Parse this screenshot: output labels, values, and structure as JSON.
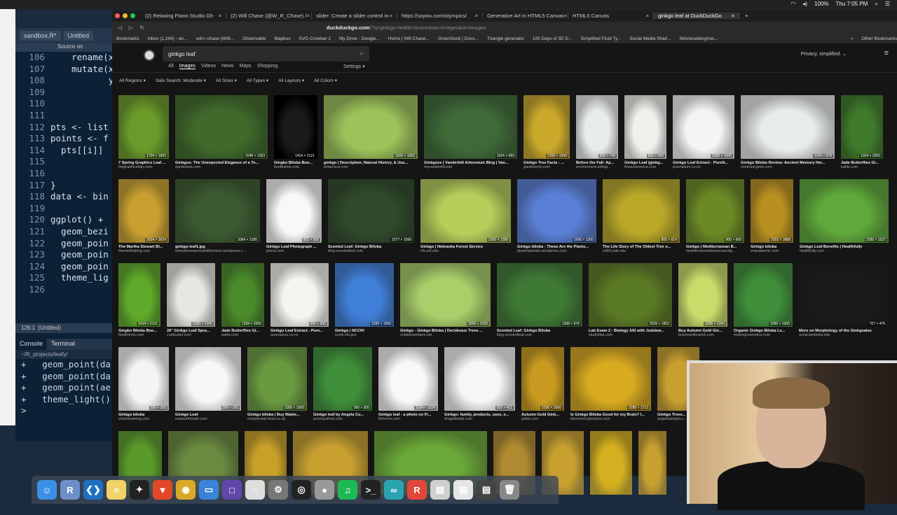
{
  "menubar": {
    "battery": "100%",
    "clock": "Thu 7:05 PM"
  },
  "rstudio": {
    "tabs": [
      "sandbox.R*",
      "Untitled"
    ],
    "source_label": "Source on",
    "code": [
      {
        "n": "106",
        "t": "    rename(x"
      },
      {
        "n": "107",
        "t": "    mutate(x"
      },
      {
        "n": "108",
        "t": "           y"
      },
      {
        "n": "109",
        "t": ""
      },
      {
        "n": "110",
        "t": ""
      },
      {
        "n": "111",
        "t": ""
      },
      {
        "n": "112",
        "t": "pts <- list"
      },
      {
        "n": "113",
        "t": "points <- f"
      },
      {
        "n": "114",
        "t": "  pts[[i]]"
      },
      {
        "n": "115",
        "t": ""
      },
      {
        "n": "116",
        "t": ""
      },
      {
        "n": "117",
        "t": "}"
      },
      {
        "n": "118",
        "t": "data <- bin"
      },
      {
        "n": "119",
        "t": ""
      },
      {
        "n": "120",
        "t": "ggplot() +"
      },
      {
        "n": "121",
        "t": "  geom_bezi"
      },
      {
        "n": "122",
        "t": "  geom_poin"
      },
      {
        "n": "123",
        "t": "  geom_poin"
      },
      {
        "n": "124",
        "t": "  geom_poin"
      },
      {
        "n": "125",
        "t": "  theme_lig"
      },
      {
        "n": "126",
        "t": ""
      }
    ],
    "cursor_pos": "126:1",
    "scope": "(Untitled)",
    "console_tabs": [
      "Console",
      "Terminal"
    ],
    "console_path": "~/R_projects/leafy/",
    "console_lines": [
      "+   geom_point(da",
      "+   geom_point(da",
      "+   geom_point(ae",
      "+   theme_light()",
      ">"
    ]
  },
  "browser": {
    "tabs": [
      {
        "title": "(2) Relaxing Piano Studio Gh"
      },
      {
        "title": "(2) Will Chase (@W_R_Chase) /"
      },
      {
        "title": "slider: Create a slider control in"
      },
      {
        "title": "https://sxywu.com/olympics/"
      },
      {
        "title": "Generative Art in HTML5 Canvas"
      },
      {
        "title": "HTML5 Canvas"
      },
      {
        "title": "ginkgo leaf at DuckDuckGo"
      }
    ],
    "url_host": "duckduckgo.com",
    "url_rest": "/?q=ginkgo+leaf&t=brave&iax=images&ia=images",
    "bookmarks": [
      "Bookmarks",
      "Inbox (1,249) - wc...",
      "will-r-chase (Willi...",
      "Observable",
      "Mapbox",
      "SVG Crowbar 2",
      "My Drive - Google...",
      "Home | Will Chase...",
      "GreenSock | Docs...",
      "Triangle generator",
      "100 Days of 3D D...",
      "Simplified Fluid Ty...",
      "Social Media Shari...",
      "felixrieseberg/res...",
      "»",
      "Other Bookmarks"
    ]
  },
  "ddg": {
    "query": "ginkgo leaf",
    "privacy": "Privacy, simplified. ⌄",
    "nav": [
      "All",
      "Images",
      "Videos",
      "News",
      "Maps",
      "Shopping"
    ],
    "settings": "Settings ▾",
    "filters": [
      "All Regions ▾",
      "Safe Search: Moderate ▾",
      "All Sizes ▾",
      "All Types ▾",
      "All Layouts ▾",
      "All Colors ▾"
    ],
    "rows": [
      [
        {
          "c": "7 Spring Graphics Leaf ...",
          "s": "thegraphicsfairy.com",
          "d": "1724 × 1800"
        },
        {
          "c": "Ginkgos: The Unexpected Elegance of a To...",
          "s": "gardenista.com",
          "d": "2048 × 1363"
        },
        {
          "c": "Gingko Biloba Boo...",
          "s": "foodtrients.com",
          "d": "1414 × 2121"
        },
        {
          "c": "ginkgo | Description, Natural History, & Use...",
          "s": "britannica.com",
          "d": "1600 × 1063"
        },
        {
          "c": "Ginkgoes | Vanderbilt Arboretum Blog | Van...",
          "s": "myvanderbilt.edu",
          "d": "1024 × 683"
        },
        {
          "c": "Ginkgo Tree Facts - ...",
          "s": "gardenerdy.com",
          "d": "1200 × 1594"
        },
        {
          "c": "Before the Fall: Ap...",
          "s": "environment.arlingt...",
          "d": "500 × 749"
        },
        {
          "c": "Ginkgo Leaf (ginkg...",
          "s": "fineartamerica.com",
          "d": "600 × 900"
        },
        {
          "c": "Ginkgo Leaf Extract - PureN...",
          "s": "purenature.co.nz",
          "d": "1000 × 1000"
        },
        {
          "c": "Ginkgo Biloba Review: Ancient Memory Her...",
          "s": "nootropicgeek.com",
          "d": "1024 × 678"
        },
        {
          "c": "Jade Butterflies Gi...",
          "s": "pahls.com",
          "d": "1334 × 2000"
        }
      ],
      [
        {
          "c": "The Martha Stewart Bl...",
          "s": "themarthablog.com",
          "d": "3024 × 3024"
        },
        {
          "c": "ginkgo-leaf1.jpg",
          "s": "whendinosaursruledthemind.wordpress.c...",
          "d": "3084 × 2185"
        },
        {
          "c": "Ginkgo Leaf Photograph ...",
          "s": "pixels.com",
          "d": "852 × 900"
        },
        {
          "c": "Scented Leaf: Ginkgo Biloba",
          "s": "blog.scentedleaf.com",
          "d": "1577 × 1099"
        },
        {
          "c": "Ginkgo | Nebraska Forest Service",
          "s": "nfs.unl.edu",
          "d": "1920 × 1280"
        },
        {
          "c": "Ginkgo biloba - These Are the Plants...",
          "s": "plantmaterials.wordpress.com",
          "d": "1600 × 1200"
        },
        {
          "c": "The Life Story of The Oldest Tree o...",
          "s": "e360.yale.edu",
          "d": "800 × 614"
        },
        {
          "c": "Ginkgo | Mediterranean B...",
          "s": "mediterraneanbonsai.wordp...",
          "d": "900 × 900"
        },
        {
          "c": "Ginkgo biloba",
          "s": "enacademic.com",
          "d": "2592 × 3888"
        },
        {
          "c": "Ginkgo Leaf Benefits | Healthfully",
          "s": "healthfully.com",
          "d": "2290 × 1527"
        }
      ],
      [
        {
          "c": "Gingko Biloba Boo...",
          "s": "foodtrients.com",
          "d": "1414 × 2121"
        },
        {
          "c": "26\" Ginkgo Leaf Spra...",
          "s": "craftoutlet.com",
          "d": "1000 × 1000"
        },
        {
          "c": "Jade Butterflies Gi...",
          "s": "pahls.com",
          "d": "1334 × 2000"
        },
        {
          "c": "Ginkgo Leaf Extract - Pure...",
          "s": "purenature.co.nz",
          "d": "600 × 600"
        },
        {
          "c": "Ginkgo | NCCIH",
          "s": "nccih.nih.gov",
          "d": "1500 × 1500"
        },
        {
          "c": "Ginkgo - Ginkgo Biloba | Deciduous Trees ...",
          "s": "coldstreamfarm.net",
          "d": "3500 × 2336"
        },
        {
          "c": "Scented Leaf: Ginkgo Biloba",
          "s": "blog.scentedleaf.com",
          "d": "1398 × 976"
        },
        {
          "c": "Lab Exam 2 - Biology 342 with Judziew...",
          "s": "studyblue.com",
          "d": "2526 × 1803"
        },
        {
          "c": "Buy Autumn Gold Gin...",
          "s": "bowerandbranch.com",
          "d": "1056 × 1260"
        },
        {
          "c": "Organic Ginkgo Biloba Le...",
          "s": "makingcosmetics.com",
          "d": "1000 × 1000"
        },
        {
          "c": "More on Morphology of the Ginkgoales",
          "s": "ucmp.berkeley.edu",
          "d": "707 × 475"
        }
      ],
      [
        {
          "c": "Ginkgo biloba",
          "s": "visionlearning.com",
          "d": "200 × 300"
        },
        {
          "c": "Ginkgo Leaf",
          "s": "eastearthtrade.com",
          "d": "200 × 160"
        },
        {
          "c": "Ginkgo biloba | Buy Maide...",
          "s": "ornamental-trees.co.uk",
          "d": "1000 × 1000"
        },
        {
          "c": "Ginkgo leaf by Angela Cu...",
          "s": "preciousflora.com",
          "d": "300 × 300"
        },
        {
          "c": "Ginkgo leaf - a photo on Fl...",
          "s": "flickriver.com",
          "d": "1024 × 1024"
        },
        {
          "c": "Ginkgo: family, products, uses, e...",
          "s": "drugsdetails.com",
          "d": "500 × 421"
        },
        {
          "c": "Autumn Gold Gink...",
          "s": "pahls.com",
          "d": "1030 × 2000"
        },
        {
          "c": "Is Ginkgo Biloba Good for my Brain? I...",
          "s": "thememorypractice.com",
          "d": "2288 × 1712"
        },
        {
          "c": "Ginkgo Trees...",
          "s": "angelospingel.c...",
          "d": ""
        }
      ],
      [
        {},
        {},
        {},
        {},
        {},
        {},
        {},
        {},
        {}
      ]
    ]
  },
  "dock": [
    {
      "name": "finder",
      "glyph": "☺",
      "color": "#3b8fe6"
    },
    {
      "name": "rstudio",
      "glyph": "R",
      "color": "#6d8fc9"
    },
    {
      "name": "vscode",
      "glyph": "❮❯",
      "color": "#1f6fc0"
    },
    {
      "name": "notes",
      "glyph": "≡",
      "color": "#f1d36a"
    },
    {
      "name": "figma",
      "glyph": "✦",
      "color": "#222"
    },
    {
      "name": "brave",
      "glyph": "▼",
      "color": "#e2472a"
    },
    {
      "name": "chrome",
      "glyph": "◉",
      "color": "#d9a92a"
    },
    {
      "name": "keynote",
      "glyph": "▭",
      "color": "#3a83d8"
    },
    {
      "name": "app",
      "glyph": "□",
      "color": "#6247aa"
    },
    {
      "name": "circle-app",
      "glyph": "○",
      "color": "#ddd"
    },
    {
      "name": "system-preferences",
      "glyph": "⚙",
      "color": "#777"
    },
    {
      "name": "obs",
      "glyph": "◎",
      "color": "#222"
    },
    {
      "name": "disk",
      "glyph": "●",
      "color": "#999"
    },
    {
      "name": "spotify",
      "glyph": "♫",
      "color": "#1db954"
    },
    {
      "name": "terminal",
      "glyph": ">_",
      "color": "#222"
    },
    {
      "name": "gitkraken",
      "glyph": "∞",
      "color": "#2aa3b0"
    },
    {
      "name": "r-app",
      "glyph": "R",
      "color": "#e2463a"
    },
    {
      "name": "window-preview",
      "glyph": "▤",
      "color": "#cfcfcf"
    },
    {
      "name": "window-preview",
      "glyph": "▤",
      "color": "#e6e6e6"
    },
    {
      "name": "window-preview",
      "glyph": "▤",
      "color": "#444"
    },
    {
      "name": "trash",
      "glyph": "🗑",
      "color": "#888"
    }
  ]
}
